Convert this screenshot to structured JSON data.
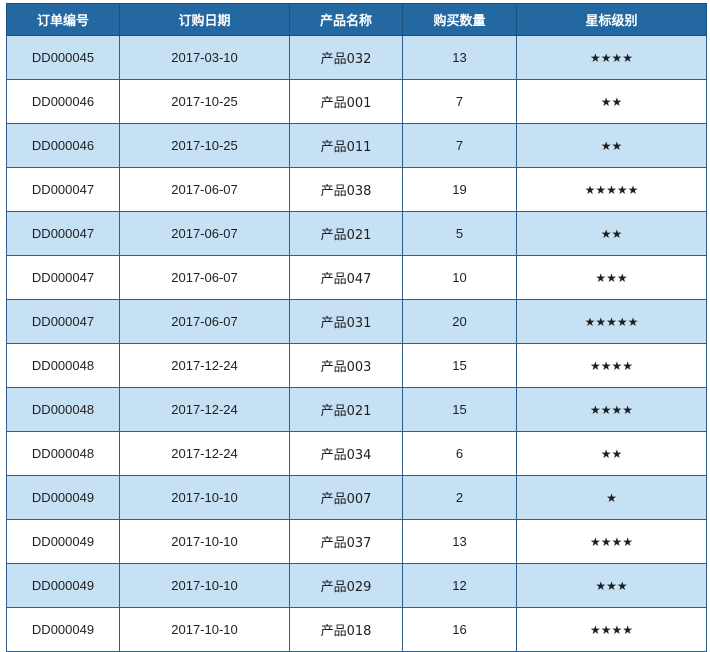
{
  "table": {
    "headers": [
      "订单编号",
      "订购日期",
      "产品名称",
      "购买数量",
      "星标级别"
    ],
    "rows": [
      {
        "order_id": "DD000045",
        "date": "2017-03-10",
        "product": "产品032",
        "qty": "13",
        "stars": "★★★★"
      },
      {
        "order_id": "DD000046",
        "date": "2017-10-25",
        "product": "产品001",
        "qty": "7",
        "stars": "★★"
      },
      {
        "order_id": "DD000046",
        "date": "2017-10-25",
        "product": "产品011",
        "qty": "7",
        "stars": "★★"
      },
      {
        "order_id": "DD000047",
        "date": "2017-06-07",
        "product": "产品038",
        "qty": "19",
        "stars": "★★★★★"
      },
      {
        "order_id": "DD000047",
        "date": "2017-06-07",
        "product": "产品021",
        "qty": "5",
        "stars": "★★"
      },
      {
        "order_id": "DD000047",
        "date": "2017-06-07",
        "product": "产品047",
        "qty": "10",
        "stars": "★★★"
      },
      {
        "order_id": "DD000047",
        "date": "2017-06-07",
        "product": "产品031",
        "qty": "20",
        "stars": "★★★★★"
      },
      {
        "order_id": "DD000048",
        "date": "2017-12-24",
        "product": "产品003",
        "qty": "15",
        "stars": "★★★★"
      },
      {
        "order_id": "DD000048",
        "date": "2017-12-24",
        "product": "产品021",
        "qty": "15",
        "stars": "★★★★"
      },
      {
        "order_id": "DD000048",
        "date": "2017-12-24",
        "product": "产品034",
        "qty": "6",
        "stars": "★★"
      },
      {
        "order_id": "DD000049",
        "date": "2017-10-10",
        "product": "产品007",
        "qty": "2",
        "stars": "★"
      },
      {
        "order_id": "DD000049",
        "date": "2017-10-10",
        "product": "产品037",
        "qty": "13",
        "stars": "★★★★"
      },
      {
        "order_id": "DD000049",
        "date": "2017-10-10",
        "product": "产品029",
        "qty": "12",
        "stars": "★★★"
      },
      {
        "order_id": "DD000049",
        "date": "2017-10-10",
        "product": "产品018",
        "qty": "16",
        "stars": "★★★★"
      }
    ]
  },
  "colors": {
    "header_bg": "#2468a2",
    "header_text": "#ffffff",
    "band_blue": "#c5e1f3",
    "band_white": "#ffffff",
    "grid": "#2f5f8a"
  }
}
